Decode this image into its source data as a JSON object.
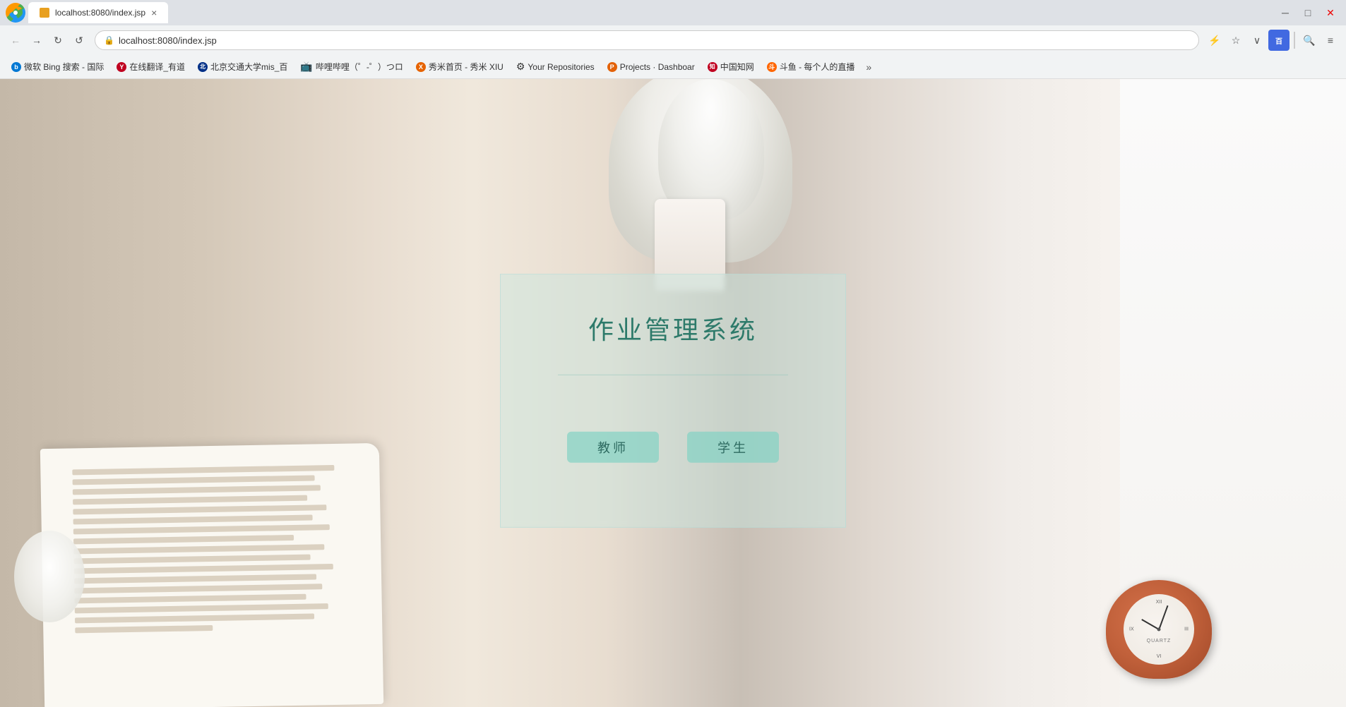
{
  "browser": {
    "address": "localhost:8080/index.jsp",
    "title": "作业管理系统"
  },
  "bookmarks": [
    {
      "id": "bing",
      "label": "微软 Bing 搜索 - 国际",
      "icon_color": "#0078d4",
      "icon_letter": "b"
    },
    {
      "id": "youdao",
      "label": "在线翻译_有道",
      "icon_color": "#c00020",
      "icon_letter": "Y"
    },
    {
      "id": "bjtu",
      "label": "北京交通大学mis_百",
      "icon_color": "#003087",
      "icon_letter": "北"
    },
    {
      "id": "bilibili",
      "label": "哔哩哔哩（゜-゜）つロ",
      "icon_color": "#fb7299",
      "icon_letter": "B"
    },
    {
      "id": "xiumei",
      "label": "秀米首页 - 秀米 XIU",
      "icon_color": "#e66300",
      "icon_letter": "X"
    },
    {
      "id": "github",
      "label": "Your Repositories",
      "icon_color": "#333",
      "icon_letter": "G"
    },
    {
      "id": "projects",
      "label": "Projects · Dashboar",
      "icon_color": "#e36209",
      "icon_letter": "P"
    },
    {
      "id": "zhiwang",
      "label": "中国知网",
      "icon_color": "#c00020",
      "icon_letter": "知"
    },
    {
      "id": "douyu",
      "label": "斗鱼 - 每个人的直播",
      "icon_color": "#f60",
      "icon_letter": "斗"
    }
  ],
  "page": {
    "title": "作业管理系统",
    "teacher_btn": "教师",
    "student_btn": "学生"
  },
  "nav": {
    "back_label": "←",
    "forward_label": "→",
    "refresh_label": "↻",
    "history_label": "↺",
    "bookmark_label": "☆",
    "baidu_label": "百度",
    "search_label": "🔍",
    "menu_label": "≡"
  }
}
